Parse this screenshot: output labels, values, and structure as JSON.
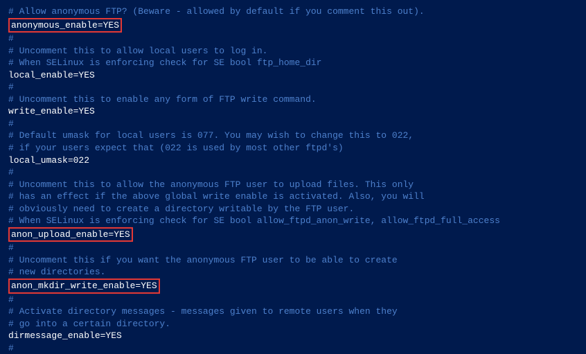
{
  "lines": [
    {
      "type": "comment",
      "text": "# Allow anonymous FTP? (Beware - allowed by default if you comment this out)."
    },
    {
      "type": "highlighted",
      "text": "anonymous_enable=YES"
    },
    {
      "type": "comment",
      "text": "#"
    },
    {
      "type": "comment",
      "text": "# Uncomment this to allow local users to log in."
    },
    {
      "type": "comment",
      "text": "# When SELinux is enforcing check for SE bool ftp_home_dir"
    },
    {
      "type": "setting",
      "text": "local_enable=YES"
    },
    {
      "type": "comment",
      "text": "#"
    },
    {
      "type": "comment",
      "text": "# Uncomment this to enable any form of FTP write command."
    },
    {
      "type": "setting",
      "text": "write_enable=YES"
    },
    {
      "type": "comment",
      "text": "#"
    },
    {
      "type": "comment",
      "text": "# Default umask for local users is 077. You may wish to change this to 022,"
    },
    {
      "type": "comment",
      "text": "# if your users expect that (022 is used by most other ftpd's)"
    },
    {
      "type": "setting",
      "text": "local_umask=022"
    },
    {
      "type": "comment",
      "text": "#"
    },
    {
      "type": "comment",
      "text": "# Uncomment this to allow the anonymous FTP user to upload files. This only"
    },
    {
      "type": "comment",
      "text": "# has an effect if the above global write enable is activated. Also, you will"
    },
    {
      "type": "comment",
      "text": "# obviously need to create a directory writable by the FTP user."
    },
    {
      "type": "comment",
      "text": "# When SELinux is enforcing check for SE bool allow_ftpd_anon_write, allow_ftpd_full_access"
    },
    {
      "type": "highlighted",
      "text": "anon_upload_enable=YES"
    },
    {
      "type": "comment",
      "text": "#"
    },
    {
      "type": "comment",
      "text": "# Uncomment this if you want the anonymous FTP user to be able to create"
    },
    {
      "type": "comment",
      "text": "# new directories."
    },
    {
      "type": "highlighted",
      "text": "anon_mkdir_write_enable=YES"
    },
    {
      "type": "comment",
      "text": "#"
    },
    {
      "type": "comment",
      "text": "# Activate directory messages - messages given to remote users when they"
    },
    {
      "type": "comment",
      "text": "# go into a certain directory."
    },
    {
      "type": "setting",
      "text": "dirmessage_enable=YES"
    },
    {
      "type": "comment",
      "text": "#"
    }
  ]
}
